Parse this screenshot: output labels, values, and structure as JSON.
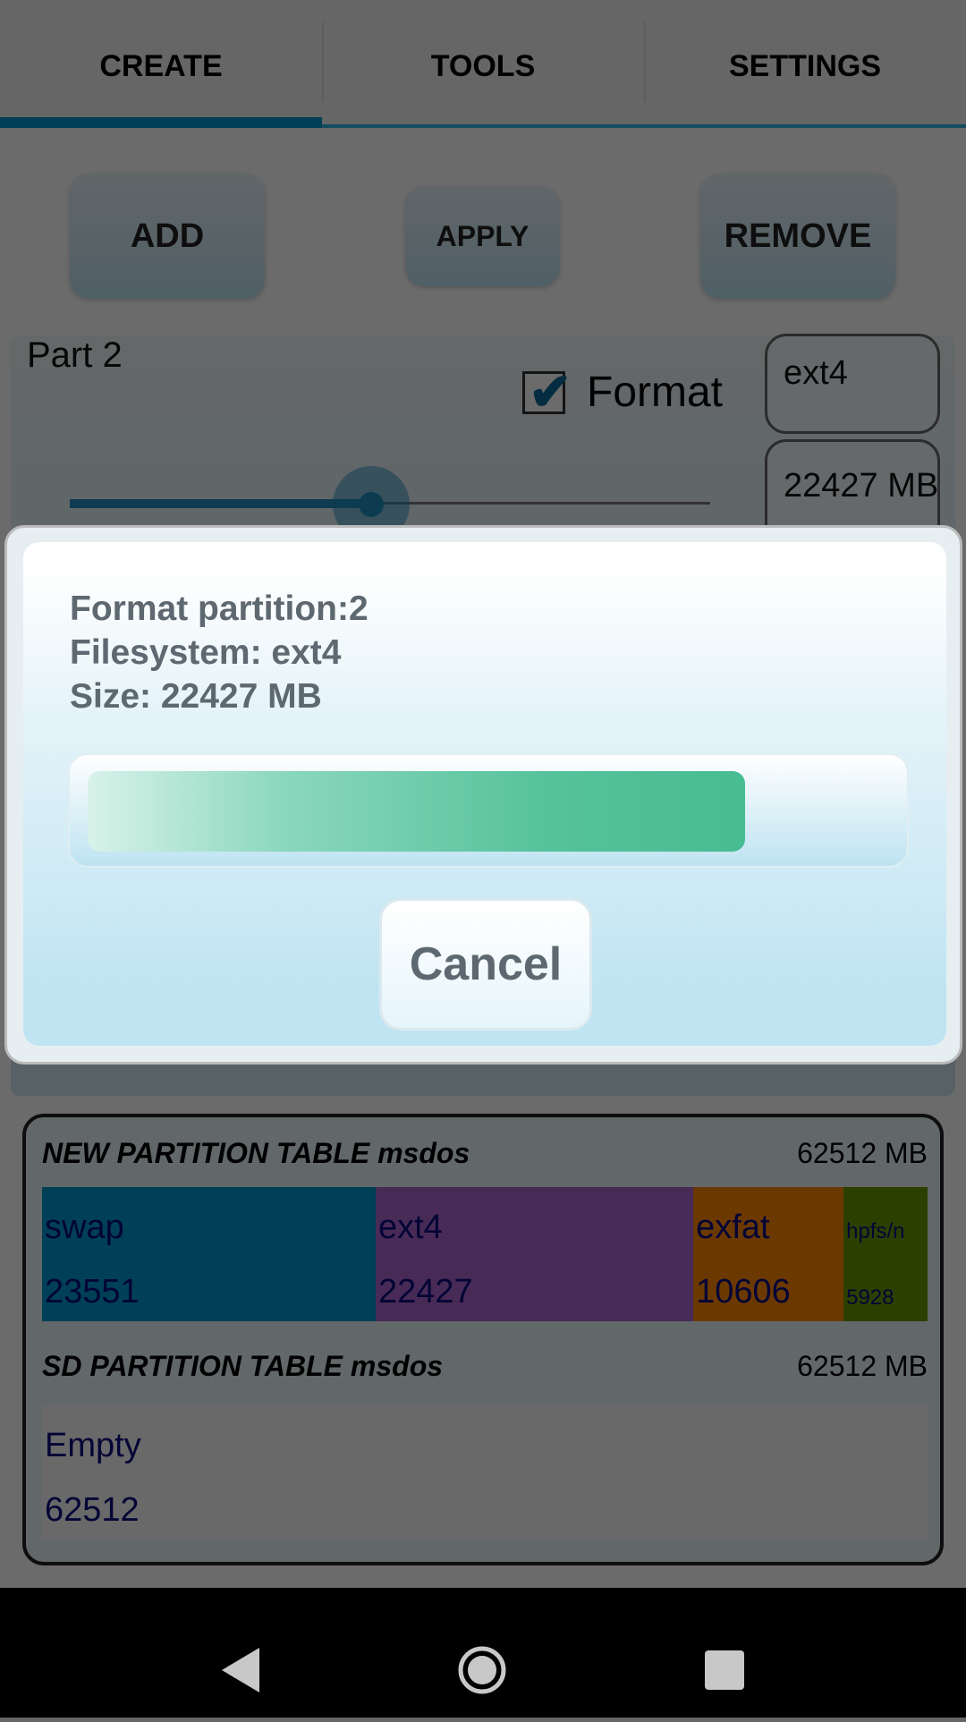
{
  "tabs": [
    {
      "label": "CREATE",
      "active": true
    },
    {
      "label": "TOOLS"
    },
    {
      "label": "SETTINGS"
    }
  ],
  "toolbar": {
    "add": "ADD",
    "apply": "APPLY",
    "remove": "REMOVE"
  },
  "partition": {
    "name": "Part 2",
    "format_label": "Format",
    "format_checked": true,
    "filesystem": "ext4",
    "size": "22427 MB",
    "slider_fraction": 0.47
  },
  "new_table": {
    "title": "NEW PARTITION TABLE msdos",
    "size": "62512 MB",
    "segments": [
      {
        "label": "swap",
        "value": "23551",
        "color": "#0099cc"
      },
      {
        "label": "ext4",
        "value": "22427",
        "color": "#aa66cc"
      },
      {
        "label": "exfat",
        "value": "10606",
        "color": "#ff8800"
      },
      {
        "label": "hpfs/n",
        "value": "5928",
        "color": "#669900"
      }
    ]
  },
  "sd_table": {
    "title": "SD PARTITION TABLE msdos",
    "size": "62512 MB",
    "label": "Empty",
    "value": "62512"
  },
  "dialog": {
    "line1": "Format partition:2",
    "line2": "Filesystem: ext4",
    "line3": "Size: 22427 MB",
    "progress": 0.82,
    "cancel": "Cancel"
  },
  "navbar": {
    "back": "back-icon",
    "home": "home-icon",
    "recents": "recents-icon"
  }
}
